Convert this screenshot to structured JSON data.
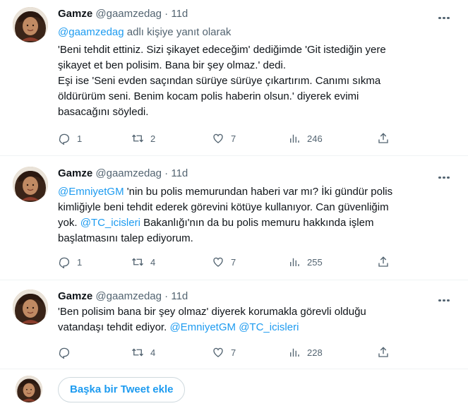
{
  "tweets": [
    {
      "name": "Gamze",
      "handle": "@gaamzedag",
      "dot": "·",
      "time": "11d",
      "reply_to_mention": "@gaamzedag",
      "reply_to_suffix": " adlı kişiye yanıt olarak",
      "lines": [
        "'Beni tehdit ettiniz. Sizi şikayet edeceğim' dediğimde 'Git istediğin yere",
        "şikayet et ben polisim. Bana bir şey olmaz.' dedi.",
        "Eşi ise 'Seni evden saçından sürüye sürüye çıkartırım. Canımı sıkma",
        "öldürürüm seni. Benim kocam polis haberin olsun.' diyerek evimi",
        "basacağını  söyledi."
      ],
      "replies": "1",
      "retweets": "2",
      "likes": "7",
      "views": "246"
    },
    {
      "name": "Gamze",
      "handle": "@gaamzedag",
      "dot": "·",
      "time": "11d",
      "line1_mention": "@EmniyetGM",
      "line1_rest": " 'nin bu polis memurundan haberi var mı? İki gündür polis",
      "line2": "kimliğiyle beni tehdit ederek görevini kötüye kullanıyor. Can güvenliğim",
      "line3_pre": "yok. ",
      "line3_mention": "@TC_icisleri",
      "line3_rest": " Bakanlığı'nın da bu polis memuru hakkında işlem",
      "line4": "başlatmasını talep ediyorum.",
      "replies": "1",
      "retweets": "4",
      "likes": "7",
      "views": "255"
    },
    {
      "name": "Gamze",
      "handle": "@gaamzedag",
      "dot": "·",
      "time": "11d",
      "line1": "'Ben polisim bana bir şey olmaz' diyerek korumakla görevli olduğu",
      "line2_pre": "vatandaşı tehdit ediyor. ",
      "line2_mention1": "@EmniyetGM",
      "line2_mention2": "@TC_icisleri",
      "replies": "",
      "retweets": "4",
      "likes": "7",
      "views": "228"
    }
  ],
  "compose": {
    "button_label": "Başka bir Tweet ekle"
  },
  "colors": {
    "accent": "#1d9bf0",
    "secondary_text": "#536471",
    "text": "#0f1419"
  },
  "icons": [
    "reply-icon",
    "retweet-icon",
    "like-icon",
    "views-icon",
    "share-icon",
    "more-icon"
  ]
}
